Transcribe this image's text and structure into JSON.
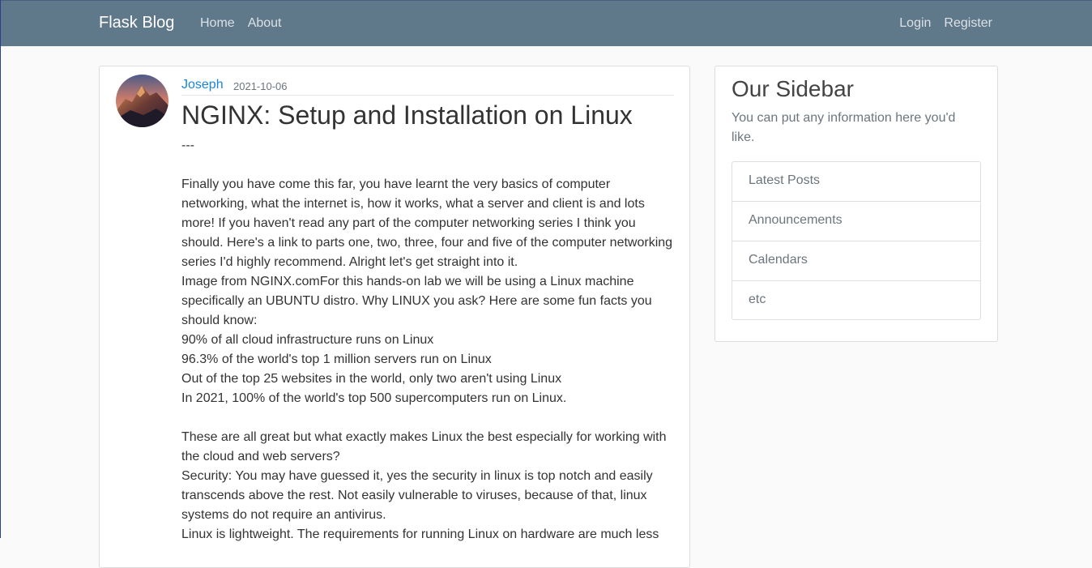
{
  "navbar": {
    "brand": "Flask Blog",
    "left_links": [
      "Home",
      "About"
    ],
    "right_links": [
      "Login",
      "Register"
    ]
  },
  "post": {
    "author": "Joseph",
    "date": "2021-10-06",
    "title": "NGINX: Setup and Installation on Linux",
    "paragraphs": [
      "---",
      "",
      "Finally you have come this far, you have learnt the very basics of computer networking, what the internet is, how it works, what a server and client is and lots more! If you haven't read any part of the computer networking series I think you should. Here's a link to parts one, two, three, four and five of the computer networking series I'd highly recommend. Alright let's get straight into it.",
      "Image from NGINX.comFor this hands-on lab we will be using a Linux machine specifically an UBUNTU distro. Why LINUX you ask? Here are some fun facts you should know:",
      "90% of all cloud infrastructure runs on Linux",
      "96.3% of the world's top 1 million servers run on Linux",
      "Out of the top 25 websites in the world, only two aren't using Linux",
      "In 2021, 100% of the world's top 500 supercomputers run on Linux.",
      "",
      "These are all great but what exactly makes Linux the best especially for working with the cloud and web servers?",
      "Security: You may have guessed it, yes the security in linux is top notch and easily transcends above the rest. Not easily vulnerable to viruses, because of that, linux systems do not require an antivirus.",
      "Linux is lightweight. The requirements for running Linux on hardware are much less"
    ]
  },
  "sidebar": {
    "title": "Our Sidebar",
    "text": "You can put any information here you'd like.",
    "items": [
      "Latest Posts",
      "Announcements",
      "Calendars",
      "etc"
    ]
  }
}
